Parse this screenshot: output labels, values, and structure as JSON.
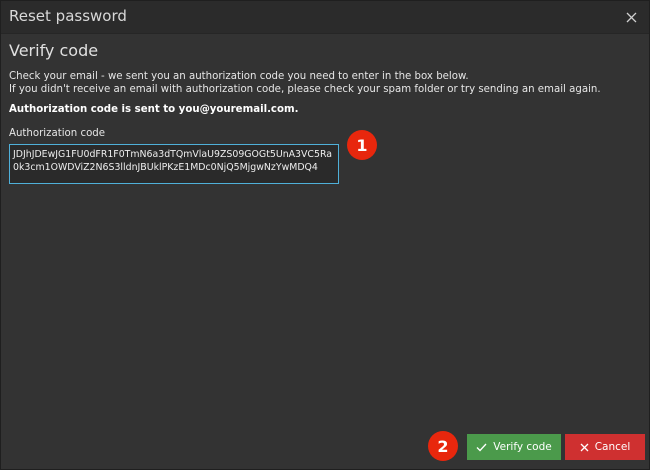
{
  "dialog": {
    "title": "Reset password"
  },
  "content": {
    "heading": "Verify code",
    "desc_line1": "Check your email - we sent you an authorization code you need to enter in the box below.",
    "desc_line2": "If you didn't receive an email with authorization code, please check your spam folder or try sending an email again.",
    "sent_notice": "Authorization code is sent to you@youremail.com.",
    "code_label": "Authorization code",
    "code_value": "JDJhJDEwJG1FU0dFR1F0TmN6a3dTQmVlaU9ZS09GOGt5UnA3VC5Ra0k3cm1OWDViZ2N6S3lldnJBUklPKzE1MDc0NjQ5MjgwNzYwMDQ4"
  },
  "badges": {
    "one": "1",
    "two": "2"
  },
  "buttons": {
    "verify_label": "Verify code",
    "cancel_label": "Cancel"
  },
  "colors": {
    "verify": "#4b9a4b",
    "cancel": "#cf3030",
    "badge": "#e8270d",
    "input_border": "#4fb0d9"
  },
  "icons": {
    "close": "close-icon",
    "check": "check-icon",
    "x": "x-icon"
  }
}
